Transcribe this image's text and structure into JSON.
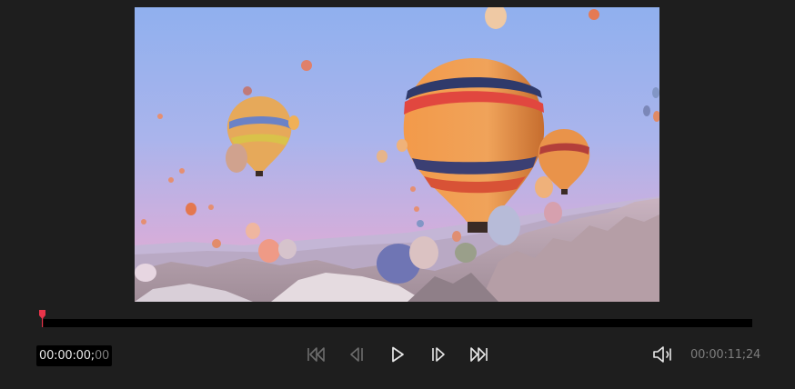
{
  "player": {
    "current_time_main": "00:00:00;",
    "current_time_frames": "00",
    "total_time": "00:00:11;24",
    "progress": 0.0,
    "accent_color": "#e8344a"
  },
  "controls": {
    "icons": [
      "skip-to-start-icon",
      "step-back-icon",
      "play-icon",
      "step-forward-icon",
      "skip-to-end-icon",
      "volume-icon"
    ]
  }
}
